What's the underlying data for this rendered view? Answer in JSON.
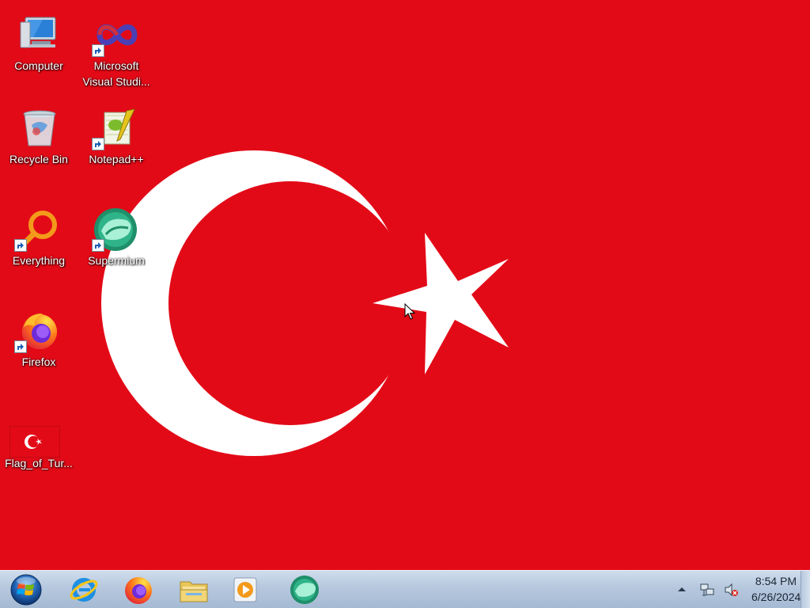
{
  "desktop": {
    "wallpaper": {
      "name": "Flag of Turkey",
      "red": "#e30a17",
      "white": "#ffffff"
    },
    "icons": [
      {
        "label": "Computer",
        "icon": "computer-icon",
        "shortcut": false
      },
      {
        "label": "Microsoft Visual Studi...",
        "label_line1": "Microsoft",
        "label_line2": "Visual Studi...",
        "icon": "visual-studio-icon",
        "shortcut": true
      },
      {
        "label": "Recycle Bin",
        "icon": "recycle-bin-icon",
        "shortcut": false
      },
      {
        "label": "Notepad++",
        "icon": "notepad-plus-plus-icon",
        "shortcut": true
      },
      {
        "label": "Everything",
        "icon": "everything-search-icon",
        "shortcut": true
      },
      {
        "label": "Supermium",
        "icon": "supermium-icon",
        "shortcut": true
      },
      {
        "label": "Firefox",
        "icon": "firefox-icon",
        "shortcut": true
      },
      {
        "label": "Flag_of_Tur...",
        "icon": "flag-image-file-icon",
        "shortcut": false
      }
    ]
  },
  "taskbar": {
    "start": {
      "icon": "windows-start-orb-icon"
    },
    "pinned": [
      {
        "name": "Internet Explorer",
        "icon": "internet-explorer-icon"
      },
      {
        "name": "Firefox",
        "icon": "firefox-icon"
      },
      {
        "name": "Windows Explorer",
        "icon": "folder-icon"
      },
      {
        "name": "Windows Media Player",
        "icon": "media-player-icon"
      },
      {
        "name": "Supermium",
        "icon": "supermium-icon"
      }
    ],
    "tray": {
      "icons": [
        "show-hidden-icons-arrow-icon",
        "network-icon",
        "volume-muted-icon"
      ],
      "time": "8:54 PM",
      "date": "6/26/2024"
    }
  },
  "colors": {
    "flag_red": "#e30a17",
    "taskbar": "#b6c8de",
    "label_text": "#ffffff"
  }
}
